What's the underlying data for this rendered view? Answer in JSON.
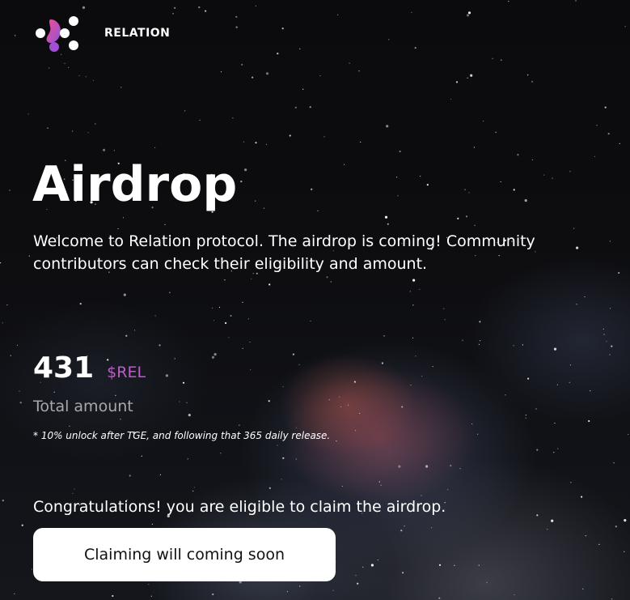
{
  "brand": {
    "logo_icon": "relation-logo-icon",
    "name": "RELATION",
    "colors": {
      "pink": "#ee4c9a",
      "purple": "#9d52d8",
      "white": "#ffffff"
    }
  },
  "hero": {
    "title": "Airdrop",
    "intro": "Welcome to Relation protocol. The airdrop is coming! Community contributors can check their eligibility and amount."
  },
  "allocation": {
    "amount": "431",
    "token": "$REL",
    "caption": "Total amount",
    "footnote": "* 10% unlock after TGE, and following that 365 daily release."
  },
  "claim": {
    "status_message": "Congratulations! you are eligible to claim the airdrop.",
    "button_label": "Claiming will coming soon"
  },
  "theme": {
    "background": "#0a0a0c",
    "accent": "#c05bc8",
    "muted_text": "#a8a8ac",
    "button_bg": "#ffffff"
  }
}
